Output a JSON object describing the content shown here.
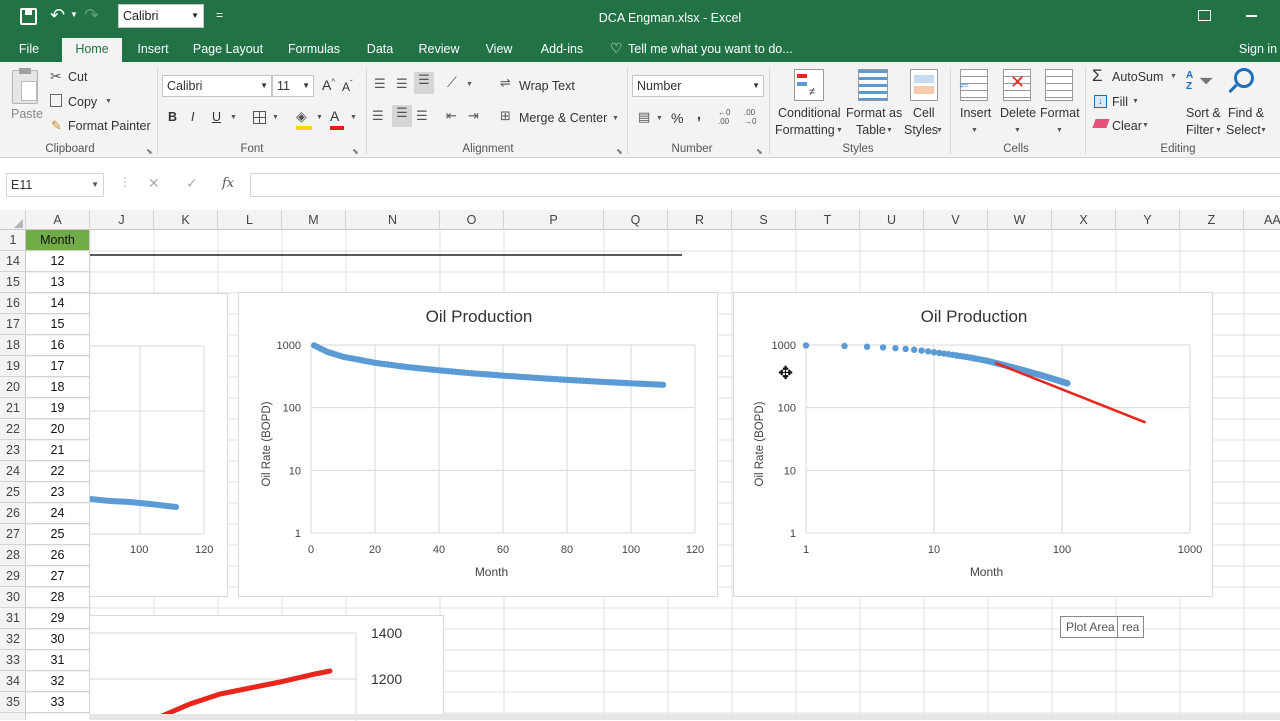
{
  "window": {
    "title": "DCA Engman.xlsx - Excel"
  },
  "qat": {
    "font_value": "Calibri"
  },
  "tabs": [
    "File",
    "Home",
    "Insert",
    "Page Layout",
    "Formulas",
    "Data",
    "Review",
    "View",
    "Add-ins"
  ],
  "tell_me": "Tell me what you want to do...",
  "sign_in": "Sign in",
  "ribbon": {
    "clipboard": {
      "paste": "Paste",
      "cut": "Cut",
      "copy": "Copy",
      "format_painter": "Format Painter",
      "label": "Clipboard"
    },
    "font": {
      "name": "Calibri",
      "size": "11",
      "bold": "B",
      "italic": "I",
      "underline": "U",
      "label": "Font"
    },
    "alignment": {
      "wrap": "Wrap Text",
      "merge": "Merge & Center",
      "label": "Alignment"
    },
    "number": {
      "format": "Number",
      "percent": "%",
      "comma": ",",
      "label": "Number"
    },
    "styles": {
      "conditional": [
        "Conditional",
        "Formatting"
      ],
      "format_table": [
        "Format as",
        "Table"
      ],
      "cell_styles": [
        "Cell",
        "Styles"
      ],
      "label": "Styles"
    },
    "cells": {
      "insert": "Insert",
      "delete": "Delete",
      "format": "Format",
      "label": "Cells"
    },
    "editing": {
      "autosum": "AutoSum",
      "fill": "Fill",
      "clear": "Clear",
      "sort": [
        "Sort &",
        "Filter"
      ],
      "find": [
        "Find &",
        "Select"
      ],
      "label": "Editing"
    }
  },
  "formula_bar": {
    "name_box": "E11",
    "fx": "fx",
    "value": ""
  },
  "columns": [
    "A",
    "J",
    "K",
    "L",
    "M",
    "N",
    "O",
    "P",
    "Q",
    "R",
    "S",
    "T",
    "U",
    "V",
    "W",
    "X",
    "Y",
    "Z",
    "AA"
  ],
  "rows": [
    "1",
    "14",
    "15",
    "16",
    "17",
    "18",
    "19",
    "20",
    "21",
    "22",
    "23",
    "24",
    "25",
    "26",
    "27",
    "28",
    "29",
    "30",
    "31",
    "32",
    "33",
    "34",
    "35"
  ],
  "columnA": [
    "Month",
    "12",
    "13",
    "14",
    "15",
    "16",
    "17",
    "18",
    "19",
    "20",
    "21",
    "22",
    "23",
    "24",
    "25",
    "26",
    "27",
    "28",
    "29",
    "30",
    "31",
    "32",
    "33"
  ],
  "colors": {
    "accent": "#217346",
    "series": "#5b9bd5",
    "fit": "#e8261c",
    "header_fill": "#70ad47"
  },
  "tooltip": "Plot Area",
  "tooltip_tail": "rea",
  "chart_data": [
    {
      "type": "scatter",
      "title": "Oil Production",
      "xlabel": "Month",
      "ylabel": "Oil Rate (BOPD)",
      "xlim": [
        0,
        120
      ],
      "ylim": [
        1,
        1000
      ],
      "y_scale": "log",
      "x_ticks": [
        "0",
        "20",
        "40",
        "60",
        "80",
        "100",
        "120"
      ],
      "y_ticks": [
        "1",
        "10",
        "100",
        "1000"
      ],
      "series": [
        {
          "x": [
            1,
            5,
            10,
            20,
            30,
            40,
            50,
            60,
            70,
            80,
            90,
            100,
            110
          ],
          "y": [
            985,
            780,
            650,
            520,
            445,
            395,
            355,
            325,
            300,
            278,
            260,
            245,
            232
          ]
        }
      ]
    },
    {
      "type": "scatter",
      "title": "Oil Production",
      "xlabel": "Month",
      "ylabel": "Oil Rate (BOPD)",
      "xlim": [
        1,
        1000
      ],
      "ylim": [
        1,
        1000
      ],
      "x_scale": "log",
      "y_scale": "log",
      "x_ticks": [
        "1",
        "10",
        "100",
        "1000"
      ],
      "y_ticks": [
        "1",
        "10",
        "100",
        "1000"
      ],
      "series": [
        {
          "x": [
            1,
            2,
            3,
            4,
            5,
            6,
            7,
            8,
            9,
            10,
            15,
            20,
            30,
            40,
            50,
            60,
            70,
            80,
            90,
            100,
            110
          ],
          "y": [
            985,
            965,
            940,
            915,
            890,
            865,
            840,
            815,
            790,
            765,
            680,
            620,
            520,
            445,
            395,
            355,
            325,
            300,
            278,
            260,
            245
          ]
        }
      ],
      "fit_line": {
        "x": [
          30,
          450
        ],
        "y": [
          520,
          58
        ]
      }
    },
    {
      "type": "scatter",
      "partial": true,
      "x_ticks": [
        "100",
        "120"
      ],
      "series": [
        {
          "note": "partial"
        }
      ]
    },
    {
      "type": "scatter",
      "partial": true,
      "y_ticks": [
        "1400",
        "1200"
      ]
    }
  ]
}
